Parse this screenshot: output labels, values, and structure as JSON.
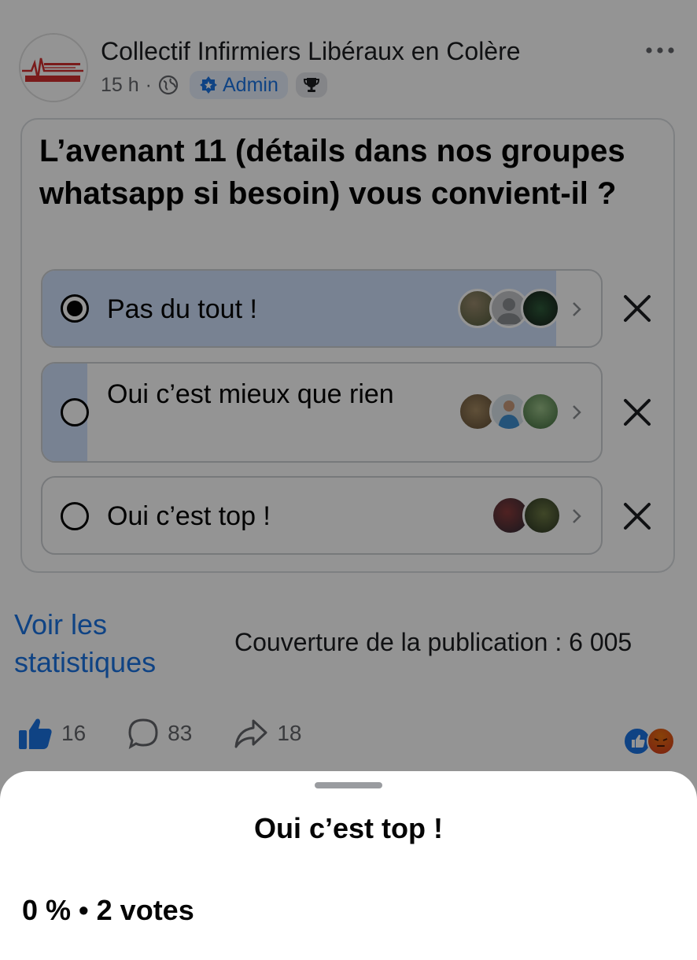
{
  "post": {
    "group_name": "Collectif Infirmiers Libéraux en Colère",
    "time": "15 h",
    "separator": "·",
    "admin_label": "Admin",
    "icons": [
      "globe-icon",
      "admin-star-icon",
      "trophy-icon",
      "more-icon"
    ]
  },
  "poll": {
    "question": "L’avenant 11 (détails dans nos groupes whatsapp si besoin) vous convient-il ?",
    "options": [
      {
        "label": "Pas du tout !",
        "selected": true,
        "share": 0.92,
        "voters": 3
      },
      {
        "label": "Oui c’est mieux que rien",
        "selected": false,
        "share": 0.08,
        "voters": 3
      },
      {
        "label": "Oui c’est top !",
        "selected": false,
        "share": 0,
        "voters": 2
      }
    ]
  },
  "footer": {
    "stats_link": "Voir les statistiques",
    "reach": "Couverture de la publication : 6 005",
    "likes": "16",
    "comments": "83",
    "shares": "18",
    "reactions": [
      "like",
      "angry"
    ]
  },
  "sheet": {
    "title": "Oui c’est top !",
    "percent": "0 %",
    "dot": "•",
    "votes": "2 votes"
  },
  "colors": {
    "accent": "#1b74e4",
    "poll_fill": "#cfe0fb",
    "overlay": "rgba(0,0,0,0.42)"
  }
}
